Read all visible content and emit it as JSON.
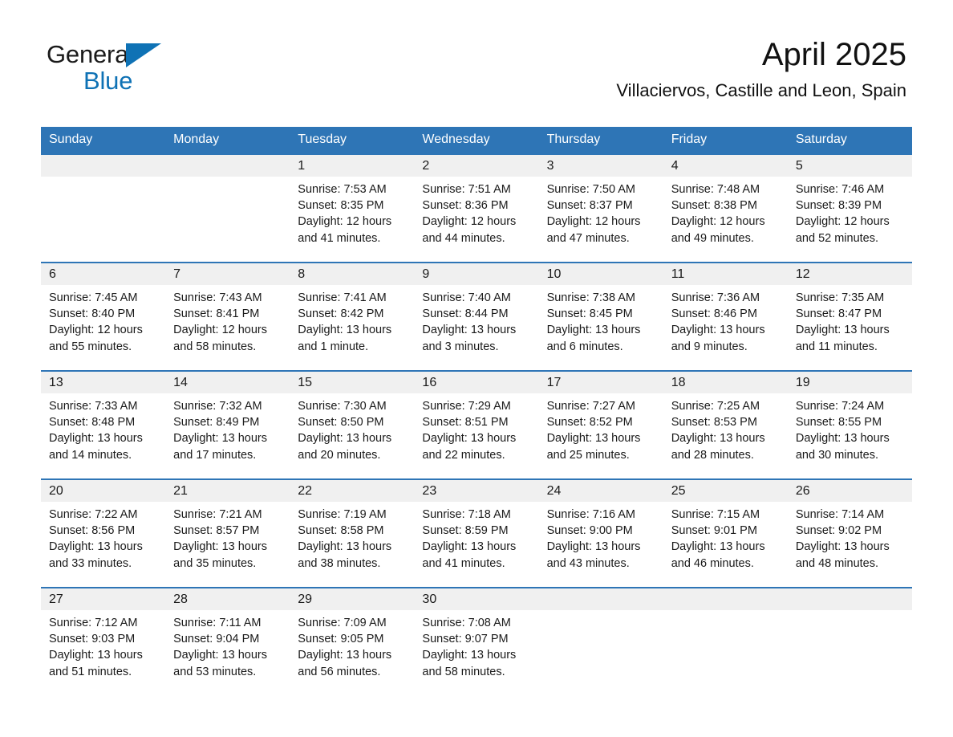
{
  "brand": {
    "line1": "General",
    "line2": "Blue",
    "triangle_color": "#0f72b5"
  },
  "header": {
    "month_title": "April 2025",
    "location": "Villaciervos, Castille and Leon, Spain"
  },
  "theme": {
    "header_blue": "#2e75b6",
    "daynum_band": "#f0f0f0",
    "text": "#1a1a1a"
  },
  "weekday_headers": [
    "Sunday",
    "Monday",
    "Tuesday",
    "Wednesday",
    "Thursday",
    "Friday",
    "Saturday"
  ],
  "weeks": [
    [
      {
        "day": "",
        "sunrise": "",
        "sunset": "",
        "daylight_line1": "",
        "daylight_line2": "",
        "blank": true
      },
      {
        "day": "",
        "sunrise": "",
        "sunset": "",
        "daylight_line1": "",
        "daylight_line2": "",
        "blank": true
      },
      {
        "day": "1",
        "sunrise": "Sunrise: 7:53 AM",
        "sunset": "Sunset: 8:35 PM",
        "daylight_line1": "Daylight: 12 hours",
        "daylight_line2": "and 41 minutes."
      },
      {
        "day": "2",
        "sunrise": "Sunrise: 7:51 AM",
        "sunset": "Sunset: 8:36 PM",
        "daylight_line1": "Daylight: 12 hours",
        "daylight_line2": "and 44 minutes."
      },
      {
        "day": "3",
        "sunrise": "Sunrise: 7:50 AM",
        "sunset": "Sunset: 8:37 PM",
        "daylight_line1": "Daylight: 12 hours",
        "daylight_line2": "and 47 minutes."
      },
      {
        "day": "4",
        "sunrise": "Sunrise: 7:48 AM",
        "sunset": "Sunset: 8:38 PM",
        "daylight_line1": "Daylight: 12 hours",
        "daylight_line2": "and 49 minutes."
      },
      {
        "day": "5",
        "sunrise": "Sunrise: 7:46 AM",
        "sunset": "Sunset: 8:39 PM",
        "daylight_line1": "Daylight: 12 hours",
        "daylight_line2": "and 52 minutes."
      }
    ],
    [
      {
        "day": "6",
        "sunrise": "Sunrise: 7:45 AM",
        "sunset": "Sunset: 8:40 PM",
        "daylight_line1": "Daylight: 12 hours",
        "daylight_line2": "and 55 minutes."
      },
      {
        "day": "7",
        "sunrise": "Sunrise: 7:43 AM",
        "sunset": "Sunset: 8:41 PM",
        "daylight_line1": "Daylight: 12 hours",
        "daylight_line2": "and 58 minutes."
      },
      {
        "day": "8",
        "sunrise": "Sunrise: 7:41 AM",
        "sunset": "Sunset: 8:42 PM",
        "daylight_line1": "Daylight: 13 hours",
        "daylight_line2": "and 1 minute."
      },
      {
        "day": "9",
        "sunrise": "Sunrise: 7:40 AM",
        "sunset": "Sunset: 8:44 PM",
        "daylight_line1": "Daylight: 13 hours",
        "daylight_line2": "and 3 minutes."
      },
      {
        "day": "10",
        "sunrise": "Sunrise: 7:38 AM",
        "sunset": "Sunset: 8:45 PM",
        "daylight_line1": "Daylight: 13 hours",
        "daylight_line2": "and 6 minutes."
      },
      {
        "day": "11",
        "sunrise": "Sunrise: 7:36 AM",
        "sunset": "Sunset: 8:46 PM",
        "daylight_line1": "Daylight: 13 hours",
        "daylight_line2": "and 9 minutes."
      },
      {
        "day": "12",
        "sunrise": "Sunrise: 7:35 AM",
        "sunset": "Sunset: 8:47 PM",
        "daylight_line1": "Daylight: 13 hours",
        "daylight_line2": "and 11 minutes."
      }
    ],
    [
      {
        "day": "13",
        "sunrise": "Sunrise: 7:33 AM",
        "sunset": "Sunset: 8:48 PM",
        "daylight_line1": "Daylight: 13 hours",
        "daylight_line2": "and 14 minutes."
      },
      {
        "day": "14",
        "sunrise": "Sunrise: 7:32 AM",
        "sunset": "Sunset: 8:49 PM",
        "daylight_line1": "Daylight: 13 hours",
        "daylight_line2": "and 17 minutes."
      },
      {
        "day": "15",
        "sunrise": "Sunrise: 7:30 AM",
        "sunset": "Sunset: 8:50 PM",
        "daylight_line1": "Daylight: 13 hours",
        "daylight_line2": "and 20 minutes."
      },
      {
        "day": "16",
        "sunrise": "Sunrise: 7:29 AM",
        "sunset": "Sunset: 8:51 PM",
        "daylight_line1": "Daylight: 13 hours",
        "daylight_line2": "and 22 minutes."
      },
      {
        "day": "17",
        "sunrise": "Sunrise: 7:27 AM",
        "sunset": "Sunset: 8:52 PM",
        "daylight_line1": "Daylight: 13 hours",
        "daylight_line2": "and 25 minutes."
      },
      {
        "day": "18",
        "sunrise": "Sunrise: 7:25 AM",
        "sunset": "Sunset: 8:53 PM",
        "daylight_line1": "Daylight: 13 hours",
        "daylight_line2": "and 28 minutes."
      },
      {
        "day": "19",
        "sunrise": "Sunrise: 7:24 AM",
        "sunset": "Sunset: 8:55 PM",
        "daylight_line1": "Daylight: 13 hours",
        "daylight_line2": "and 30 minutes."
      }
    ],
    [
      {
        "day": "20",
        "sunrise": "Sunrise: 7:22 AM",
        "sunset": "Sunset: 8:56 PM",
        "daylight_line1": "Daylight: 13 hours",
        "daylight_line2": "and 33 minutes."
      },
      {
        "day": "21",
        "sunrise": "Sunrise: 7:21 AM",
        "sunset": "Sunset: 8:57 PM",
        "daylight_line1": "Daylight: 13 hours",
        "daylight_line2": "and 35 minutes."
      },
      {
        "day": "22",
        "sunrise": "Sunrise: 7:19 AM",
        "sunset": "Sunset: 8:58 PM",
        "daylight_line1": "Daylight: 13 hours",
        "daylight_line2": "and 38 minutes."
      },
      {
        "day": "23",
        "sunrise": "Sunrise: 7:18 AM",
        "sunset": "Sunset: 8:59 PM",
        "daylight_line1": "Daylight: 13 hours",
        "daylight_line2": "and 41 minutes."
      },
      {
        "day": "24",
        "sunrise": "Sunrise: 7:16 AM",
        "sunset": "Sunset: 9:00 PM",
        "daylight_line1": "Daylight: 13 hours",
        "daylight_line2": "and 43 minutes."
      },
      {
        "day": "25",
        "sunrise": "Sunrise: 7:15 AM",
        "sunset": "Sunset: 9:01 PM",
        "daylight_line1": "Daylight: 13 hours",
        "daylight_line2": "and 46 minutes."
      },
      {
        "day": "26",
        "sunrise": "Sunrise: 7:14 AM",
        "sunset": "Sunset: 9:02 PM",
        "daylight_line1": "Daylight: 13 hours",
        "daylight_line2": "and 48 minutes."
      }
    ],
    [
      {
        "day": "27",
        "sunrise": "Sunrise: 7:12 AM",
        "sunset": "Sunset: 9:03 PM",
        "daylight_line1": "Daylight: 13 hours",
        "daylight_line2": "and 51 minutes."
      },
      {
        "day": "28",
        "sunrise": "Sunrise: 7:11 AM",
        "sunset": "Sunset: 9:04 PM",
        "daylight_line1": "Daylight: 13 hours",
        "daylight_line2": "and 53 minutes."
      },
      {
        "day": "29",
        "sunrise": "Sunrise: 7:09 AM",
        "sunset": "Sunset: 9:05 PM",
        "daylight_line1": "Daylight: 13 hours",
        "daylight_line2": "and 56 minutes."
      },
      {
        "day": "30",
        "sunrise": "Sunrise: 7:08 AM",
        "sunset": "Sunset: 9:07 PM",
        "daylight_line1": "Daylight: 13 hours",
        "daylight_line2": "and 58 minutes."
      },
      {
        "day": "",
        "sunrise": "",
        "sunset": "",
        "daylight_line1": "",
        "daylight_line2": "",
        "blank": true
      },
      {
        "day": "",
        "sunrise": "",
        "sunset": "",
        "daylight_line1": "",
        "daylight_line2": "",
        "blank": true
      },
      {
        "day": "",
        "sunrise": "",
        "sunset": "",
        "daylight_line1": "",
        "daylight_line2": "",
        "blank": true
      }
    ]
  ]
}
